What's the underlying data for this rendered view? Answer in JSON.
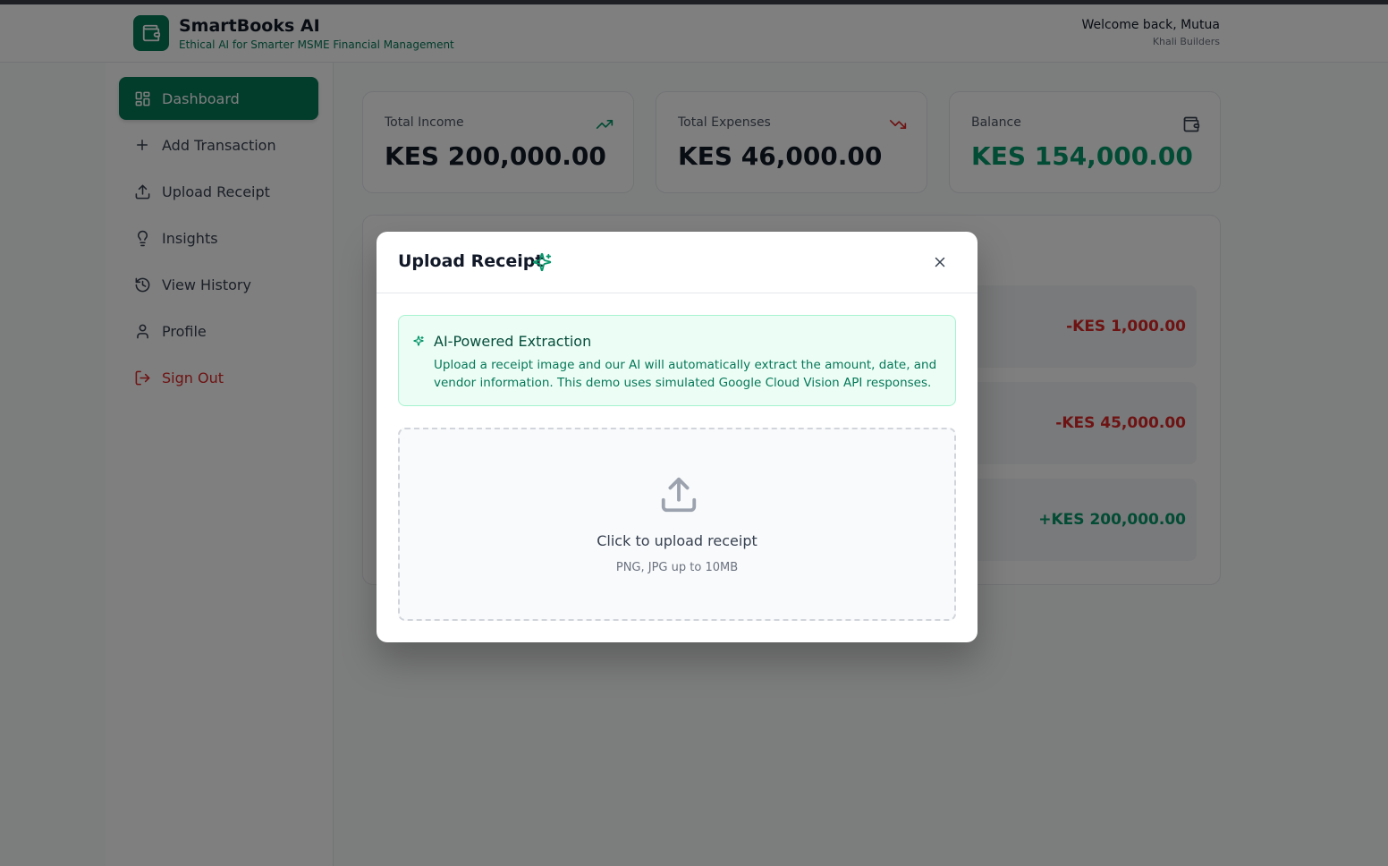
{
  "header": {
    "app_title": "SmartBooks AI",
    "app_subtitle": "Ethical AI for Smarter MSME Financial Management",
    "welcome": "Welcome back, Mutua",
    "company": "Khali Builders"
  },
  "sidebar": {
    "items": [
      {
        "label": "Dashboard",
        "icon": "dashboard-grid-icon",
        "active": true
      },
      {
        "label": "Add Transaction",
        "icon": "plus-icon"
      },
      {
        "label": "Upload Receipt",
        "icon": "upload-icon"
      },
      {
        "label": "Insights",
        "icon": "lightbulb-icon"
      },
      {
        "label": "View History",
        "icon": "history-icon"
      },
      {
        "label": "Profile",
        "icon": "user-icon"
      },
      {
        "label": "Sign Out",
        "icon": "sign-out-icon"
      }
    ]
  },
  "summary": {
    "income_label": "Total Income",
    "income_value": "KES 200,000.00",
    "expenses_label": "Total Expenses",
    "expenses_value": "KES 46,000.00",
    "balance_label": "Balance",
    "balance_value": "KES 154,000.00"
  },
  "transactions": [
    {
      "amount": "-KES 1,000.00",
      "type": "expense"
    },
    {
      "amount": "-KES 45,000.00",
      "type": "expense"
    },
    {
      "amount": "+KES 200,000.00",
      "type": "income"
    }
  ],
  "modal": {
    "title": "Upload Receipt",
    "ai_title": "AI-Powered Extraction",
    "ai_description": "Upload a receipt image and our AI will automatically extract the amount, date, and vendor information. This demo uses simulated Google Cloud Vision API responses.",
    "drop_title": "Click to upload receipt",
    "drop_hint": "PNG, JPG up to 10MB"
  },
  "colors": {
    "brand": "#047857",
    "income": "#059669",
    "expense": "#dc2626"
  }
}
